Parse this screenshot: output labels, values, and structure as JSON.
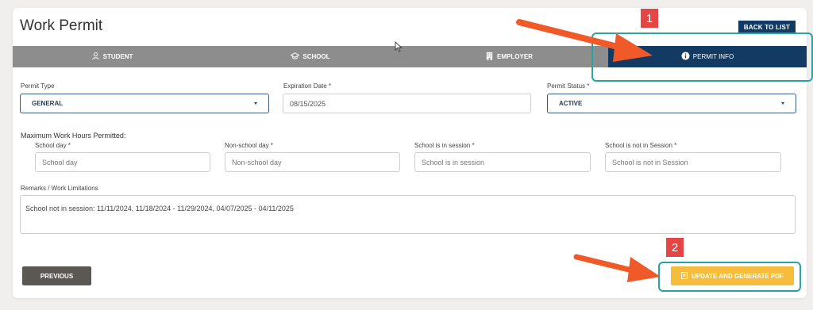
{
  "page": {
    "title": "Work Permit",
    "back_label": "BACK TO LIST"
  },
  "tabs": [
    {
      "label": "STUDENT",
      "icon": "user-icon"
    },
    {
      "label": "SCHOOL",
      "icon": "graduation-cap-icon"
    },
    {
      "label": "EMPLOYER",
      "icon": "building-icon"
    },
    {
      "label": "PERMIT INFO",
      "icon": "info-icon",
      "active": true
    }
  ],
  "fields": {
    "permit_type": {
      "label": "Permit Type",
      "value": "GENERAL"
    },
    "expiration_date": {
      "label": "Expiration Date *",
      "value": "08/15/2025"
    },
    "permit_status": {
      "label": "Permit Status *",
      "value": "ACTIVE"
    }
  },
  "hours": {
    "section_label": "Maximum Work Hours Permitted:",
    "school_day": {
      "label": "School day *",
      "placeholder": "School day"
    },
    "non_school_day": {
      "label": "Non-school day *",
      "placeholder": "Non-school day"
    },
    "in_session": {
      "label": "School is in session *",
      "placeholder": "School is in session"
    },
    "not_in_session": {
      "label": "School is not in Session *",
      "placeholder": "School is not in Session"
    }
  },
  "remarks": {
    "label": "Remarks / Work Limitations",
    "value": "School not in session: 11/11/2024, 11/18/2024 - 11/29/2024, 04/07/2025 - 04/11/2025"
  },
  "actions": {
    "previous_label": "PREVIOUS",
    "generate_label": "UPDATE AND GENERATE PDF"
  },
  "annotations": [
    {
      "number": "1"
    },
    {
      "number": "2"
    }
  ],
  "colors": {
    "nav_active": "#123a63",
    "tab_bar": "#8d8d8d",
    "primary_action": "#f6bd3c",
    "highlight": "#2aa3a3",
    "badge": "#e64545",
    "arrow": "#f05a28"
  }
}
